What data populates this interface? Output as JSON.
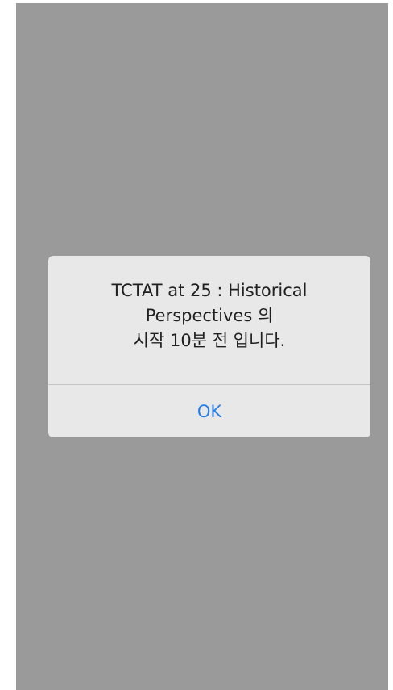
{
  "alert": {
    "message_lines": [
      "TCTAT at 25 : Historical",
      "Perspectives 의",
      "시작 10분 전 입니다."
    ],
    "ok_label": "OK"
  },
  "colors": {
    "overlay": "#9a9a9a",
    "dialog_background": "#e8e8e8",
    "message_text": "#1f1f1f",
    "button_text": "#2a7de1",
    "divider": "#c4c4c4"
  }
}
